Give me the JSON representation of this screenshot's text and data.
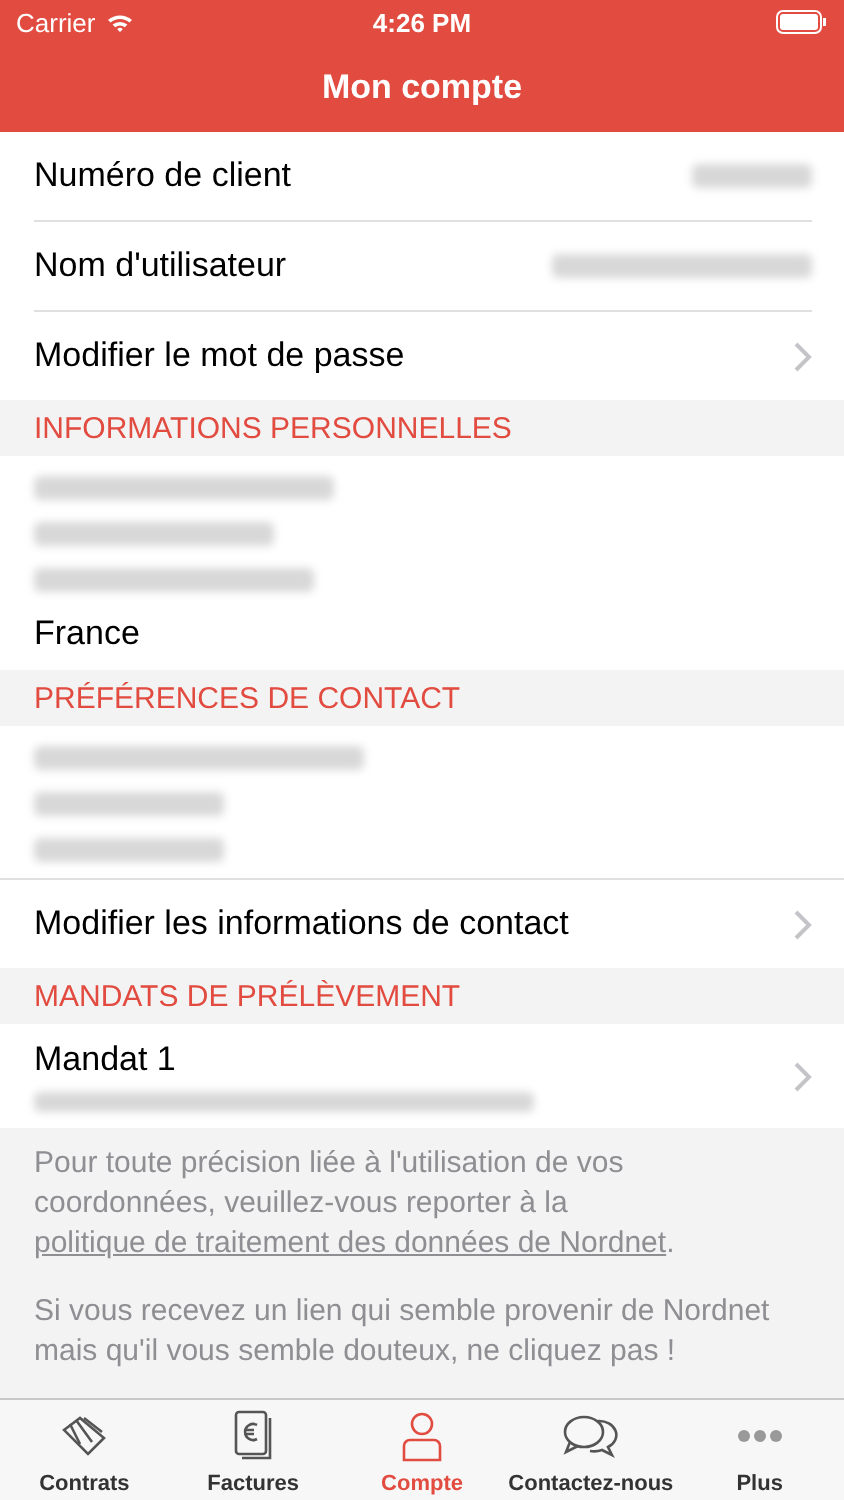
{
  "status_bar": {
    "carrier": "Carrier",
    "time": "4:26 PM"
  },
  "navigation": {
    "title": "Mon compte"
  },
  "items": [
    {
      "kind": "row",
      "label": "Numéro de client",
      "value_redacted": true,
      "chevron": false
    },
    {
      "kind": "row",
      "label": "Nom d'utilisateur",
      "value_redacted": true,
      "chevron": false
    },
    {
      "kind": "row",
      "label": "Modifier le mot de passe",
      "value_redacted": false,
      "chevron": true
    },
    {
      "kind": "header",
      "label": "INFORMATIONS PERSONNELLES"
    },
    {
      "kind": "block",
      "lines": [
        {
          "kind": "redacted"
        },
        {
          "kind": "redacted"
        },
        {
          "kind": "redacted"
        },
        {
          "kind": "text",
          "text": "France"
        }
      ]
    },
    {
      "kind": "header",
      "label": "PRÉFÉRENCES DE CONTACT"
    },
    {
      "kind": "block",
      "lines": [
        {
          "kind": "redacted"
        },
        {
          "kind": "redacted"
        },
        {
          "kind": "redacted"
        }
      ]
    },
    {
      "kind": "row",
      "label": "Modifier les informations de contact",
      "value_redacted": false,
      "chevron": true
    },
    {
      "kind": "header",
      "label": "MANDATS DE PRÉLÈVEMENT"
    },
    {
      "kind": "row",
      "label": "Mandat 1",
      "value_redacted": false,
      "chevron": true,
      "lines": [
        {
          "kind": "redacted"
        }
      ]
    }
  ],
  "footer": {
    "paragraphs": [
      {
        "before": "Pour toute précision liée à l'utilisation de vos coordonnées, veuillez-vous reporter à la ",
        "link": "politique de traitement des données de Nordnet",
        "after": "."
      },
      {
        "before": "Si vous recevez un lien qui semble provenir de Nordnet mais qu'il vous semble douteux, ne cliquez pas !"
      }
    ]
  },
  "tabs": [
    {
      "label": "Contrats",
      "selected": false
    },
    {
      "label": "Factures",
      "selected": false
    },
    {
      "label": "Compte",
      "selected": true
    },
    {
      "label": "Contactez-nous",
      "selected": false
    },
    {
      "label": "Plus",
      "selected": false
    }
  ]
}
